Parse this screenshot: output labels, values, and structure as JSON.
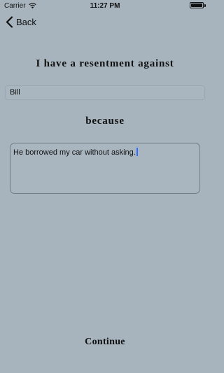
{
  "status_bar": {
    "carrier": "Carrier",
    "time": "11:27 PM",
    "wifi_icon": "wifi-icon",
    "battery_icon": "battery-icon",
    "battery_level": 1.0
  },
  "nav": {
    "back_label": "Back",
    "back_icon": "chevron-left-icon"
  },
  "form": {
    "heading_1": "I have a resentment against",
    "name_value": "Bill",
    "heading_2": "because",
    "reason_value": "He borrowed my car without asking."
  },
  "footer": {
    "continue_label": "Continue"
  },
  "colors": {
    "background": "#a7b4bd",
    "text": "#111111",
    "caret": "#2f6bff"
  }
}
